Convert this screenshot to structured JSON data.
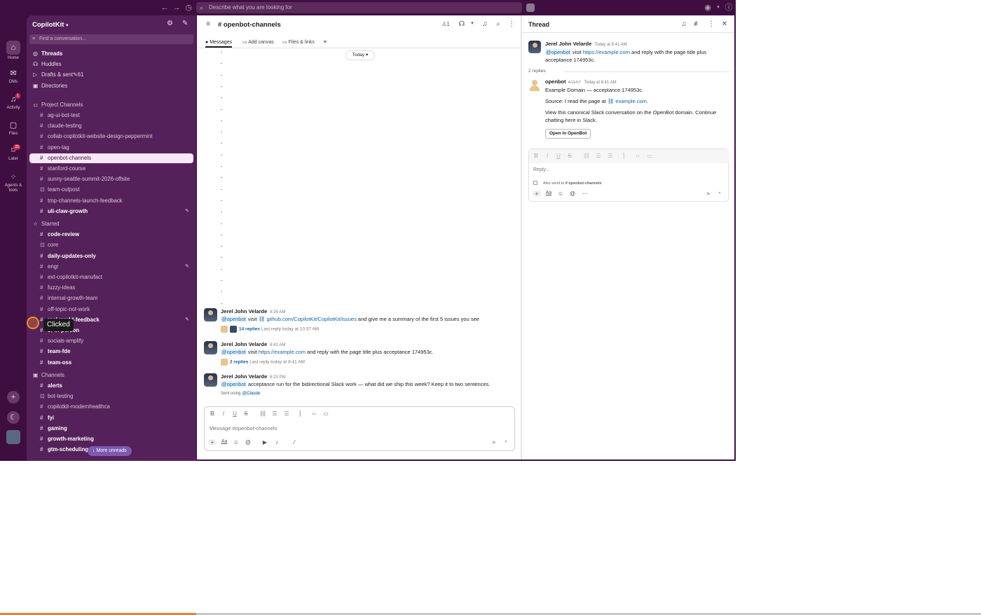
{
  "topbar": {
    "search_placeholder": "Describe what you are looking for"
  },
  "rail": [
    {
      "label": "Home",
      "icon": "home-icon"
    },
    {
      "label": "DMs",
      "icon": "dms-icon"
    },
    {
      "label": "Activity",
      "icon": "bell-icon",
      "badge": "1"
    },
    {
      "label": "Files",
      "icon": "files-icon"
    },
    {
      "label": "Later",
      "icon": "bookmark-icon",
      "badge": "25"
    },
    {
      "label": "Agents & tools",
      "icon": "agents-icon"
    }
  ],
  "sidebar": {
    "workspace": "CopilotKit",
    "find_placeholder": "Find a conversation...",
    "top": [
      {
        "label": "Threads",
        "bold": true
      },
      {
        "label": "Huddles"
      },
      {
        "label": "Drafts & sent",
        "right": "61"
      },
      {
        "label": "Directories"
      }
    ],
    "project_channels_label": "Project Channels",
    "project_channels": [
      {
        "label": "ag-ui-bot-test"
      },
      {
        "label": "claude-testing"
      },
      {
        "label": "collab-copilotkit-website-design-peppermint"
      },
      {
        "label": "open-tag"
      },
      {
        "label": "openbot-channels",
        "selected": true
      },
      {
        "label": "stanford-course"
      },
      {
        "label": "sunny-seattle-summit-2026-offsite"
      },
      {
        "label": "team-outpost",
        "lock": true
      },
      {
        "label": "tmp-channels-launch-feedback"
      },
      {
        "label": "uli-claw-growth",
        "bold": true,
        "edit": true
      }
    ],
    "starred_label": "Starred",
    "starred": [
      {
        "label": "code-review",
        "bold": true
      },
      {
        "label": "core",
        "lock": true
      },
      {
        "label": "daily-updates-only",
        "bold": true
      },
      {
        "label": "engr",
        "edit": true
      },
      {
        "label": "ext-copilotkit-manufact"
      },
      {
        "label": "fuzzy-ideas"
      },
      {
        "label": "internal-growth-team"
      },
      {
        "label": "off-topic-not-work"
      },
      {
        "label": "real-world-feedback",
        "bold": true,
        "edit": true
      },
      {
        "label": "sf-in-person",
        "bold": true
      },
      {
        "label": "socials-amplify"
      },
      {
        "label": "team-fde",
        "bold": true
      },
      {
        "label": "team-oss",
        "bold": true
      }
    ],
    "channels_label": "Channels",
    "channels": [
      {
        "label": "alerts",
        "bold": true
      },
      {
        "label": "bot-testing",
        "lock": true
      },
      {
        "label": "copilotkit-modernhealthca"
      },
      {
        "label": "fyi",
        "bold": true
      },
      {
        "label": "gaming",
        "bold": true
      },
      {
        "label": "growth-marketing",
        "bold": true
      },
      {
        "label": "gtm-scheduling",
        "bold": true
      }
    ],
    "more_unreads": "More unreads"
  },
  "main": {
    "channel_title": "# openbot-channels",
    "member_count": "1",
    "tabs": [
      {
        "label": "Messages",
        "active": true
      },
      {
        "label": "Add canvas"
      },
      {
        "label": "Files & links"
      }
    ],
    "date_divider": "Today",
    "messages": [
      {
        "author": "Jerel John Velarde",
        "time": "8:35 AM",
        "mention": "@openbot",
        "pre": " visit ",
        "link": "github.com/CopilotKit/CopilotKit/issues",
        "post": " and give me a summary of the first 5 issues you see",
        "replies": "14 replies",
        "last_reply": "Last reply today at 10:37 AM"
      },
      {
        "author": "Jerel John Velarde",
        "time": "8:41 AM",
        "mention": "@openbot",
        "pre": "  visit ",
        "link": "https://example.com",
        "post": " and reply with the page title plus acceptance 174953c.",
        "replies": "2 replies",
        "last_reply": "Last reply today at 8:41 AM"
      },
      {
        "author": "Jerel John Velarde",
        "time": "6:20 PM",
        "mention": "@openbot",
        "pre": " acceptance run for the bidirectional Slack work — what did we ship this week? Keep it to two sentences.",
        "link": "",
        "post": "",
        "sent_using": "Sent using",
        "sent_mention": "@Claude"
      }
    ],
    "clicked_label": "Clicked",
    "composer_placeholder": "Message #openbot-channels"
  },
  "thread": {
    "title": "Thread",
    "parent": {
      "author": "Jerel John Velarde",
      "time": "Today at 8:41 AM",
      "mention": "@openbot",
      "pre": "  visit ",
      "link": "https://example.com",
      "post": " and reply with the page title plus acceptance 174953c."
    },
    "reply_count": "2 replies",
    "reply": {
      "author": "openbot",
      "tag": "AGENT",
      "time": "Today at 8:41 AM",
      "line1": "Example Domain — acceptance 174953c.",
      "line2_pre": "Source: I read the page at ",
      "line2_link": "example.com",
      "line2_post": ".",
      "line3": "View this canonical Slack conversation on the OpenBot domain. Continue chatting here in Slack.",
      "button": "Open in OpenBot"
    },
    "reply_placeholder": "Reply...",
    "also_send_pre": "Also send to",
    "also_send_channel": "# openbot-channels"
  }
}
